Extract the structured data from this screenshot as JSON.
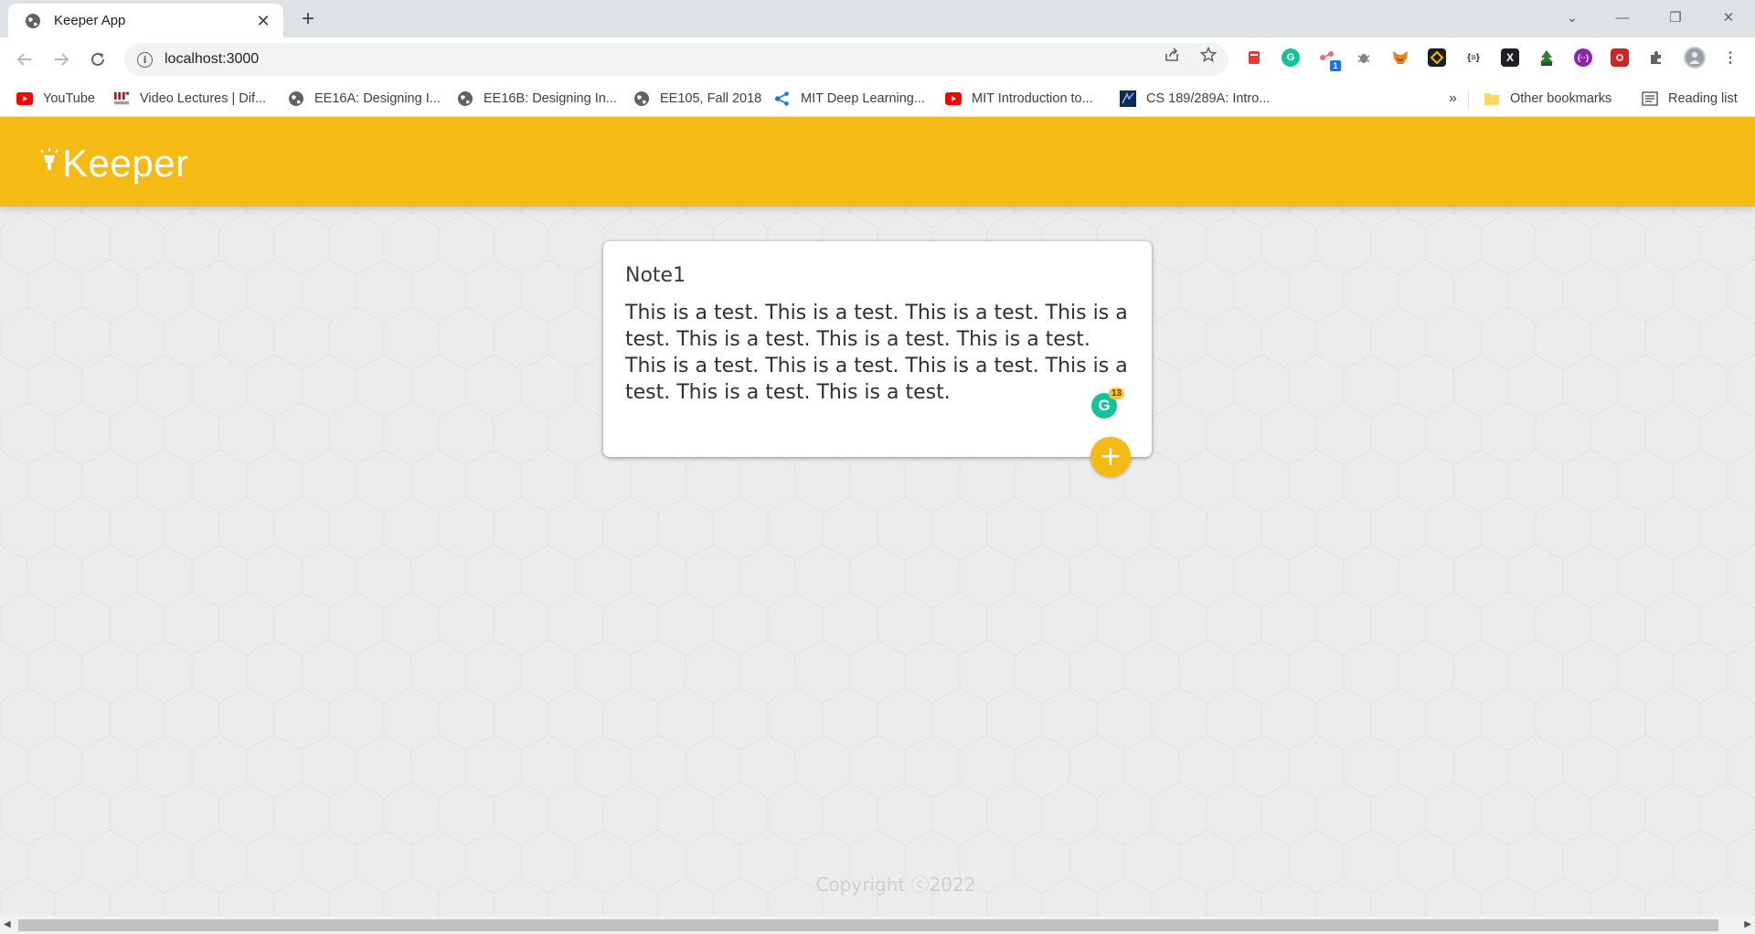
{
  "browser": {
    "tab_title": "Keeper App",
    "tab_close": "✕",
    "new_tab": "+",
    "window_controls": {
      "dropdown": "⌄",
      "minimize": "—",
      "restore": "❐",
      "close": "✕"
    },
    "url": "localhost:3000",
    "extension_badge": "1",
    "bookmarks": [
      {
        "label": "YouTube",
        "icon": "youtube-icon"
      },
      {
        "label": "Video Lectures | Dif...",
        "icon": "mit-icon"
      },
      {
        "label": "EE16A: Designing I...",
        "icon": "globe-icon"
      },
      {
        "label": "EE16B: Designing In...",
        "icon": "globe-icon"
      },
      {
        "label": "EE105, Fall 2018",
        "icon": "globe-icon"
      },
      {
        "label": "MIT Deep Learning...",
        "icon": "network-icon"
      },
      {
        "label": "MIT Introduction to...",
        "icon": "youtube-icon"
      },
      {
        "label": "CS 189/289A: Intro...",
        "icon": "cs-icon"
      }
    ],
    "bookmarks_overflow": "»",
    "other_bookmarks": "Other bookmarks",
    "reading_list": "Reading list"
  },
  "app": {
    "brand": "Keeper",
    "note": {
      "title": "Note1",
      "content": "This is a test. This is a test. This is a test. This is a test. This is a test. This is a test. This is a test. This is a test. This is a test. This is a test. This is a test. This is a test. This is a test."
    },
    "grammarly_letter": "G",
    "grammarly_count": "13",
    "add_button": "+",
    "footer": "Copyright ⓒ2022"
  },
  "colors": {
    "accent": "#f5ba13",
    "background": "#ececec"
  }
}
